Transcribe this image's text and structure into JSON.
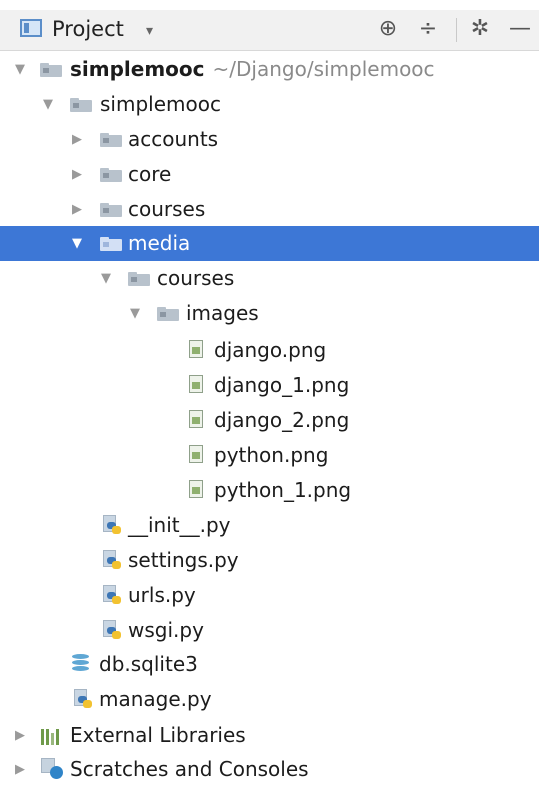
{
  "toolbar": {
    "title": "Project",
    "caret": "▾",
    "icons": {
      "locate": "⊕",
      "collapse": "÷",
      "settings": "✲",
      "hide": "—"
    }
  },
  "tree": [
    {
      "id": "root",
      "label": "simplemooc",
      "path": "~/Django/simplemooc",
      "arrow": "▼",
      "icon": "folder",
      "bold": true
    },
    {
      "id": "simplemooc-pkg",
      "label": "simplemooc",
      "arrow": "▼",
      "icon": "folder"
    },
    {
      "id": "accounts",
      "label": "accounts",
      "arrow": "▶",
      "icon": "folder"
    },
    {
      "id": "core",
      "label": "core",
      "arrow": "▶",
      "icon": "folder"
    },
    {
      "id": "courses",
      "label": "courses",
      "arrow": "▶",
      "icon": "folder"
    },
    {
      "id": "media",
      "label": "media",
      "arrow": "▼",
      "icon": "folder",
      "selected": true
    },
    {
      "id": "media-courses",
      "label": "courses",
      "arrow": "▼",
      "icon": "folder"
    },
    {
      "id": "images",
      "label": "images",
      "arrow": "▼",
      "icon": "folder"
    },
    {
      "id": "django-png",
      "label": "django.png",
      "icon": "image-file"
    },
    {
      "id": "django1-png",
      "label": "django_1.png",
      "icon": "image-file"
    },
    {
      "id": "django2-png",
      "label": "django_2.png",
      "icon": "image-file"
    },
    {
      "id": "python-png",
      "label": "python.png",
      "icon": "image-file"
    },
    {
      "id": "python1-png",
      "label": "python_1.png",
      "icon": "image-file"
    },
    {
      "id": "init-py",
      "label": "__init__.py",
      "icon": "python-file"
    },
    {
      "id": "settings-py",
      "label": "settings.py",
      "icon": "python-file"
    },
    {
      "id": "urls-py",
      "label": "urls.py",
      "icon": "python-file"
    },
    {
      "id": "wsgi-py",
      "label": "wsgi.py",
      "icon": "python-file"
    },
    {
      "id": "db-sqlite3",
      "label": "db.sqlite3",
      "icon": "database"
    },
    {
      "id": "manage-py",
      "label": "manage.py",
      "icon": "python-file"
    },
    {
      "id": "external-libraries",
      "label": "External Libraries",
      "arrow": "▶",
      "icon": "library"
    },
    {
      "id": "scratches",
      "label": "Scratches and Consoles",
      "arrow": "▶",
      "icon": "scratches"
    }
  ]
}
